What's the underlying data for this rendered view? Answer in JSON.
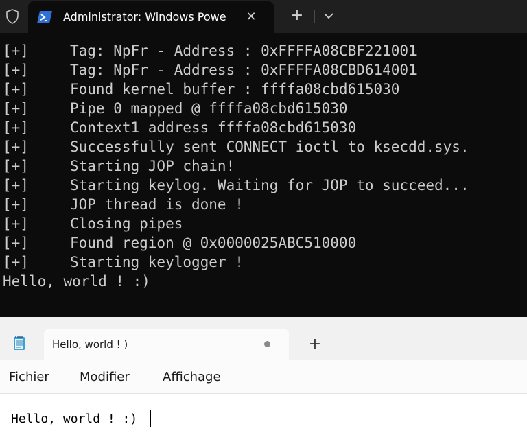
{
  "terminal": {
    "tab_title": "Administrator: Windows Powe",
    "prefix": "[+]",
    "lines": [
      "Tag: NpFr - Address : 0xFFFFA08CBF221001",
      "Tag: NpFr - Address : 0xFFFFA08CBD614001",
      "Found kernel buffer : ffffa08cbd615030",
      "Pipe 0 mapped @ ffffa08cbd615030",
      "Context1 address ffffa08cbd615030",
      "Successfully sent CONNECT ioctl to ksecdd.sys.",
      "Starting JOP chain!",
      "Starting keylog. Waiting for JOP to succeed...",
      "JOP thread is done !",
      "Closing pipes",
      "Found region @ 0x0000025ABC510000",
      "Starting keylogger !"
    ],
    "output_line": "Hello, world ! :)",
    "icons": {
      "shield": "shield-icon",
      "powershell": "powershell-icon",
      "close": "close-icon",
      "new_tab": "plus-icon",
      "dropdown": "chevron-down-icon"
    },
    "colors": {
      "background": "#0c0c0c",
      "titlebar": "#1f1f1f",
      "text": "#cccccc",
      "ps_blue": "#2f6fd6"
    }
  },
  "notepad": {
    "tab_title": "Hello, world ! )",
    "menu": [
      "Fichier",
      "Modifier",
      "Affichage"
    ],
    "content": "Hello, world ! :)",
    "icons": {
      "app": "notepad-icon",
      "unsaved": "unsaved-dot-icon",
      "new_tab": "plus-icon"
    },
    "colors": {
      "background": "#fbfbfb",
      "tabbar": "#f1f1f1",
      "editor": "#ffffff"
    }
  }
}
